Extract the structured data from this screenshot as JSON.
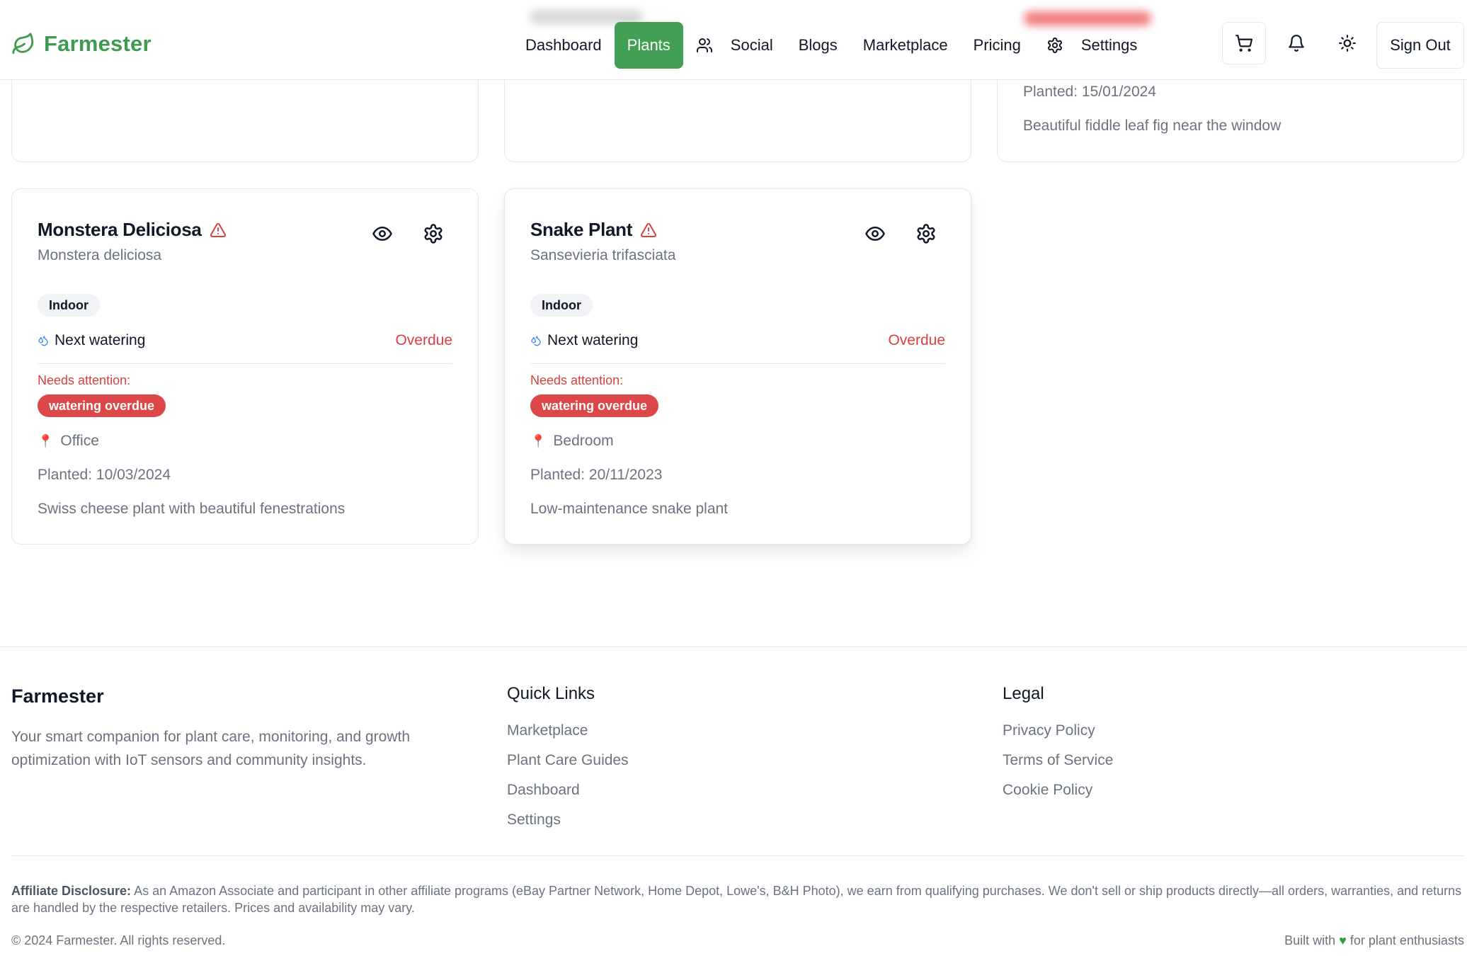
{
  "header": {
    "brand": "Farmester",
    "nav": [
      {
        "label": "Dashboard"
      },
      {
        "label": "Plants",
        "active": true
      },
      {
        "label": "Social",
        "icon": "users-icon"
      },
      {
        "label": "Blogs"
      },
      {
        "label": "Marketplace"
      },
      {
        "label": "Pricing"
      },
      {
        "label": "Settings",
        "icon": "gear-icon"
      }
    ],
    "cart_icon": "cart-icon",
    "bell_icon": "bell-icon",
    "theme_icon": "sun-icon",
    "signout_label": "Sign Out"
  },
  "top_cards": {
    "right": {
      "planted": "Planted: 15/01/2024",
      "description": "Beautiful fiddle leaf fig near the window"
    }
  },
  "plants": [
    {
      "name": "Monstera Deliciosa",
      "scientific": "Monstera deliciosa",
      "tag": "Indoor",
      "watering_label": "Next watering",
      "watering_status": "Overdue",
      "attention_label": "Needs attention:",
      "issue": "watering overdue",
      "location": "Office",
      "planted": "Planted: 10/03/2024",
      "description": "Swiss cheese plant with beautiful fenestrations"
    },
    {
      "name": "Snake Plant",
      "scientific": "Sansevieria trifasciata",
      "tag": "Indoor",
      "watering_label": "Next watering",
      "watering_status": "Overdue",
      "attention_label": "Needs attention:",
      "issue": "watering overdue",
      "location": "Bedroom",
      "planted": "Planted: 20/11/2023",
      "description": "Low-maintenance snake plant"
    }
  ],
  "footer": {
    "brand": "Farmester",
    "description": "Your smart companion for plant care, monitoring, and growth optimization with IoT sensors and community insights.",
    "quick_links_title": "Quick Links",
    "quick_links": [
      "Marketplace",
      "Plant Care Guides",
      "Dashboard",
      "Settings"
    ],
    "legal_title": "Legal",
    "legal_links": [
      "Privacy Policy",
      "Terms of Service",
      "Cookie Policy"
    ],
    "affiliate_title": "Affiliate Disclosure:",
    "affiliate_text": "As an Amazon Associate and participant in other affiliate programs (eBay Partner Network, Home Depot, Lowe's, B&H Photo), we earn from qualifying purchases. We don't sell or ship products directly—all orders, warranties, and returns are handled by the respective retailers. Prices and availability may vary.",
    "copyright": "© 2024 Farmester. All rights reserved.",
    "built_prefix": "Built with",
    "built_suffix": "for plant enthusiasts"
  },
  "colors": {
    "brand_green": "#42a055",
    "danger_red": "#dc3f3f",
    "muted_text": "#6b7280"
  }
}
